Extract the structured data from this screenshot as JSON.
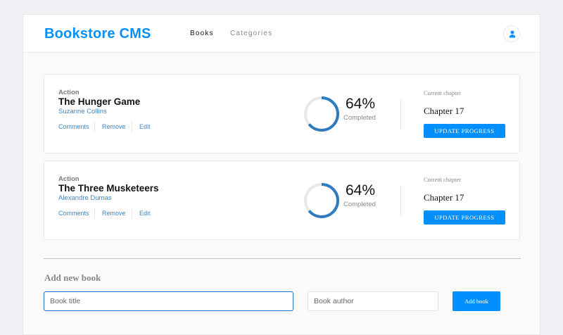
{
  "header": {
    "logo": "Bookstore CMS",
    "nav": [
      {
        "label": "Books",
        "active": true
      },
      {
        "label": "Categories",
        "active": false
      }
    ],
    "user_icon": "user-icon"
  },
  "books": [
    {
      "genre": "Action",
      "title": "The Hunger Game",
      "author": "Suzanne Collins",
      "actions": [
        "Comments",
        "Remove",
        "Edit"
      ],
      "progress_value": 0.64,
      "percent": "64%",
      "completed_label": "Completed",
      "chapter_label": "Current chapter",
      "chapter": "Chapter 17",
      "update_button": "UPDATE PROGRESS"
    },
    {
      "genre": "Action",
      "title": "The Three Musketeers",
      "author": "Alexandre Dumas",
      "actions": [
        "Comments",
        "Remove",
        "Edit"
      ],
      "progress_value": 0.64,
      "percent": "64%",
      "completed_label": "Completed",
      "chapter_label": "Current chapter",
      "chapter": "Chapter 17",
      "update_button": "UPDATE PROGRESS"
    }
  ],
  "form": {
    "title": "Add new book",
    "title_placeholder": "Book title",
    "author_placeholder": "Book author",
    "submit_label": "Add book"
  },
  "colors": {
    "accent": "#0290ff",
    "link": "#4386bf",
    "progress": "#307bbe",
    "progress_track": "#e8e8e8"
  }
}
